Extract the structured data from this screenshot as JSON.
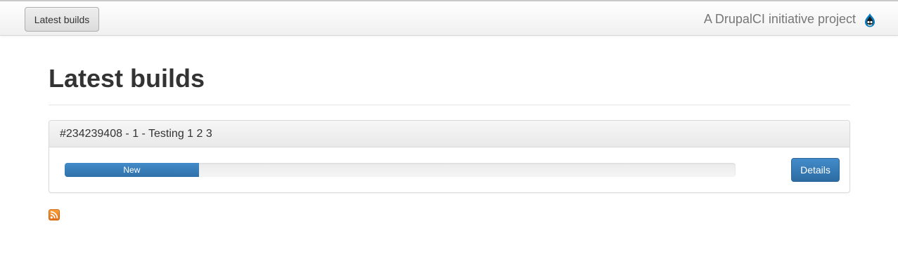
{
  "navbar": {
    "button_label": "Latest builds",
    "brand_text": "A DrupalCI initiative project",
    "brand_icon": "drupal-drop-icon"
  },
  "main": {
    "title": "Latest builds",
    "builds": [
      {
        "heading": "#234239408 - 1 - Testing 1 2 3",
        "status": "New",
        "progress_percent": 20,
        "details_label": "Details"
      }
    ],
    "feed_icon": "rss-icon"
  },
  "colors": {
    "primary": "#428bca",
    "rss": "#f38a1c",
    "brand_text": "#777777"
  }
}
